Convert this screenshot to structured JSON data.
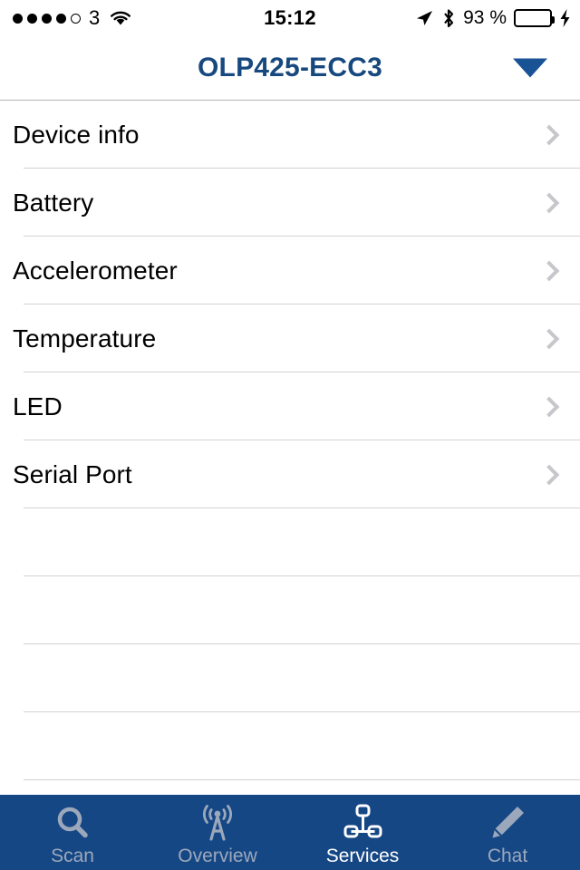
{
  "status_bar": {
    "signal_dots_filled": 4,
    "signal_dots_total": 5,
    "carrier": "3",
    "wifi_icon": "wifi-icon",
    "time": "15:12",
    "location_icon": "location-arrow-icon",
    "bluetooth_icon": "bluetooth-icon",
    "battery_percent": "93 %",
    "battery_level": 93,
    "battery_color": "#36D74E",
    "charging_icon": "lightning-bolt-icon",
    "is_charging": true
  },
  "navbar": {
    "title": "OLP425-ECC3",
    "title_color": "#17497F",
    "dropdown_icon": "triangle-down-icon"
  },
  "list": {
    "chevron_icon": "chevron-right-icon",
    "rows": [
      {
        "label": "Device info",
        "has_chevron": true
      },
      {
        "label": "Battery",
        "has_chevron": true
      },
      {
        "label": "Accelerometer",
        "has_chevron": true
      },
      {
        "label": "Temperature",
        "has_chevron": true
      },
      {
        "label": "LED",
        "has_chevron": true
      },
      {
        "label": "Serial Port",
        "has_chevron": true
      },
      {
        "label": "",
        "has_chevron": false
      },
      {
        "label": "",
        "has_chevron": false
      },
      {
        "label": "",
        "has_chevron": false
      },
      {
        "label": "",
        "has_chevron": false
      }
    ]
  },
  "tabbar": {
    "background_color": "#164785",
    "active_color": "#FFFFFF",
    "inactive_color": "#9BA8BC",
    "tabs": [
      {
        "label": "Scan",
        "icon": "magnifier-icon",
        "active": false
      },
      {
        "label": "Overview",
        "icon": "broadcast-tower-icon",
        "active": false
      },
      {
        "label": "Services",
        "icon": "network-tree-icon",
        "active": true
      },
      {
        "label": "Chat",
        "icon": "pencil-icon",
        "active": false
      }
    ]
  }
}
